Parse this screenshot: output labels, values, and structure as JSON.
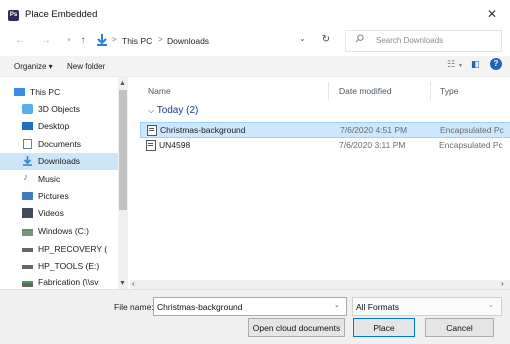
{
  "window": {
    "title": "Place Embedded",
    "app_badge": "Ps"
  },
  "address": {
    "crumbs": [
      "This PC",
      "Downloads"
    ],
    "separator": ">"
  },
  "search": {
    "placeholder": "Search Downloads"
  },
  "toolbar": {
    "organize": "Organize ▾",
    "new_folder": "New folder"
  },
  "sidebar": {
    "items": [
      {
        "label": "This PC",
        "icon": "pc-icon",
        "color": "#3a8ee6"
      },
      {
        "label": "3D Objects",
        "icon": "cube-icon",
        "color": "#5aaee8"
      },
      {
        "label": "Desktop",
        "icon": "desktop-icon",
        "color": "#1e6fc8"
      },
      {
        "label": "Documents",
        "icon": "document-icon",
        "color": "#6b7fa3"
      },
      {
        "label": "Downloads",
        "icon": "download-icon",
        "color": "#2f7fd8",
        "selected": true
      },
      {
        "label": "Music",
        "icon": "music-icon",
        "color": "#3a8ee6"
      },
      {
        "label": "Pictures",
        "icon": "pictures-icon",
        "color": "#3f7cc2"
      },
      {
        "label": "Videos",
        "icon": "videos-icon",
        "color": "#414a5a"
      },
      {
        "label": "Windows (C:)",
        "icon": "drive-icon",
        "color": "#4a9c5a"
      },
      {
        "label": "HP_RECOVERY (",
        "icon": "drive-icon",
        "color": "#666666"
      },
      {
        "label": "HP_TOOLS (E:)",
        "icon": "drive-icon",
        "color": "#666666"
      },
      {
        "label": "Fabrication (\\\\sv",
        "icon": "network-drive-icon",
        "color": "#4a9c5a"
      }
    ]
  },
  "columns": {
    "name": "Name",
    "date": "Date modified",
    "type": "Type"
  },
  "group": {
    "label": "Today (2)"
  },
  "files": [
    {
      "name": "Christmas-background",
      "date": "7/6/2020 4:51 PM",
      "type": "Encapsulated Pc",
      "selected": true
    },
    {
      "name": "UN4598",
      "date": "7/6/2020 3:11 PM",
      "type": "Encapsulated Pc",
      "selected": false
    }
  ],
  "footer": {
    "file_name_label": "File name:",
    "file_name_value": "Christmas-background",
    "format": "All Formats",
    "open_cloud": "Open cloud documents",
    "place": "Place",
    "cancel": "Cancel"
  }
}
